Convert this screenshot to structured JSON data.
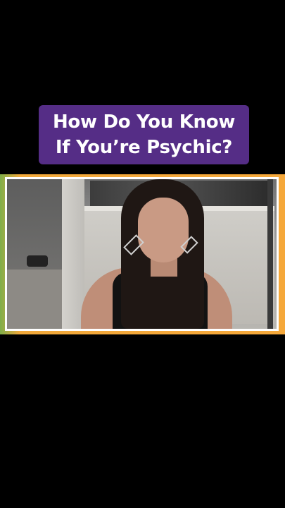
{
  "title": {
    "line1": "How Do You Know",
    "line2": "If You’re Psychic?"
  },
  "colors": {
    "title_background": "#552d86",
    "frame_border": "#f5a83a",
    "frame_border_left_accent": "#7fae4a",
    "page_background": "#000000"
  },
  "video": {
    "description_icon": "person-video"
  }
}
